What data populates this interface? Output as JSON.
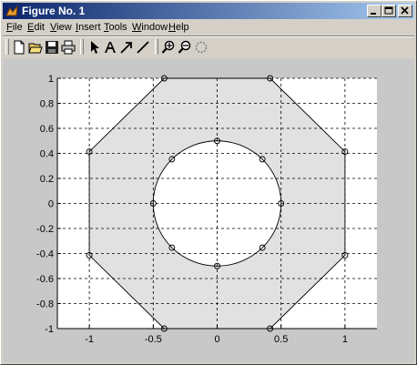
{
  "window": {
    "title": "Figure No. 1"
  },
  "menu": [
    "File",
    "Edit",
    "View",
    "Insert",
    "Tools",
    "Window",
    "Help"
  ],
  "toolbar": {
    "icons": [
      "new-figure-icon",
      "open-file-icon",
      "save-icon",
      "print-icon",
      "select-arrow-icon",
      "insert-text-icon",
      "insert-arrow-icon",
      "insert-line-icon",
      "zoom-in-icon",
      "zoom-out-icon",
      "rotate-3d-icon"
    ]
  },
  "colors": {
    "title_bar_start": "#0a246a",
    "title_bar_end": "#a6caf0",
    "figure_bg": "#c8c8c8",
    "axes_bg": "#ffffff",
    "patch_fill": "#e1e1e1"
  },
  "chart_data": {
    "type": "area",
    "title": "",
    "xlabel": "",
    "ylabel": "",
    "xlim": [
      -1.25,
      1.25
    ],
    "ylim": [
      -1,
      1
    ],
    "xticks": [
      -1,
      -0.5,
      0,
      0.5,
      1
    ],
    "xtick_labels": [
      "-1",
      "-0.5",
      "0",
      "0.5",
      "1"
    ],
    "yticks": [
      -1,
      -0.8,
      -0.6,
      -0.4,
      -0.2,
      0,
      0.2,
      0.4,
      0.6,
      0.8,
      1
    ],
    "ytick_labels": [
      "-1",
      "-0.8",
      "-0.6",
      "-0.4",
      "-0.2",
      "0",
      "0.2",
      "0.4",
      "0.6",
      "0.8",
      "1"
    ],
    "grid": true,
    "series": [
      {
        "values": [
          [
            0.4142,
            1
          ],
          [
            1,
            0.4142
          ],
          [
            1,
            -0.4142
          ],
          [
            0.4142,
            -1
          ],
          [
            -0.4142,
            -1
          ],
          [
            -1,
            -0.4142
          ],
          [
            -1,
            0.4142
          ],
          [
            -0.4142,
            1
          ]
        ],
        "marker": "o",
        "closed": true
      },
      {
        "values": [
          [
            0.5,
            0
          ],
          [
            0.3536,
            0.3536
          ],
          [
            0,
            0.5
          ],
          [
            -0.3536,
            0.3536
          ],
          [
            -0.5,
            0
          ],
          [
            -0.3536,
            -0.3536
          ],
          [
            0,
            -0.5
          ],
          [
            0.3536,
            -0.3536
          ]
        ],
        "marker": "o",
        "closed": true,
        "curve": "circle"
      }
    ]
  }
}
